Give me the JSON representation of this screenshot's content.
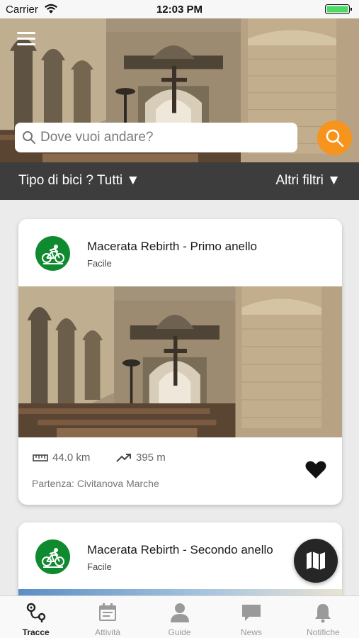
{
  "status_bar": {
    "carrier": "Carrier",
    "time": "12:03 PM",
    "battery_color": "#4cd964"
  },
  "header": {
    "menu_icon": "hamburger-menu-icon",
    "search": {
      "placeholder": "Dove vuoi andare?",
      "value": "",
      "button_icon": "search-icon",
      "button_color": "#f7941d"
    }
  },
  "filters": {
    "bike_type_label": "Tipo di bici ? Tutti ▼",
    "more_filters_label": "Altri filtri ▼"
  },
  "tracks": [
    {
      "title": "Macerata Rebirth - Primo anello",
      "difficulty": "Facile",
      "badge_icon": "cyclist-icon",
      "badge_color": "#0f8a2f",
      "distance": "44.0 km",
      "elevation": "395 m",
      "departure": "Partenza: Civitanova Marche",
      "favorite_icon": "heart-icon"
    },
    {
      "title": "Macerata Rebirth - Secondo anello",
      "difficulty": "Facile",
      "badge_icon": "cyclist-icon",
      "badge_color": "#0f8a2f"
    }
  ],
  "map_button_icon": "map-icon",
  "tabbar": {
    "items": [
      {
        "label": "Tracce",
        "icon": "route-icon",
        "active": true
      },
      {
        "label": "Attività",
        "icon": "calendar-icon",
        "active": false
      },
      {
        "label": "Guide",
        "icon": "person-icon",
        "active": false
      },
      {
        "label": "News",
        "icon": "chat-icon",
        "active": false
      },
      {
        "label": "Notifiche",
        "icon": "bell-icon",
        "active": false
      }
    ]
  }
}
